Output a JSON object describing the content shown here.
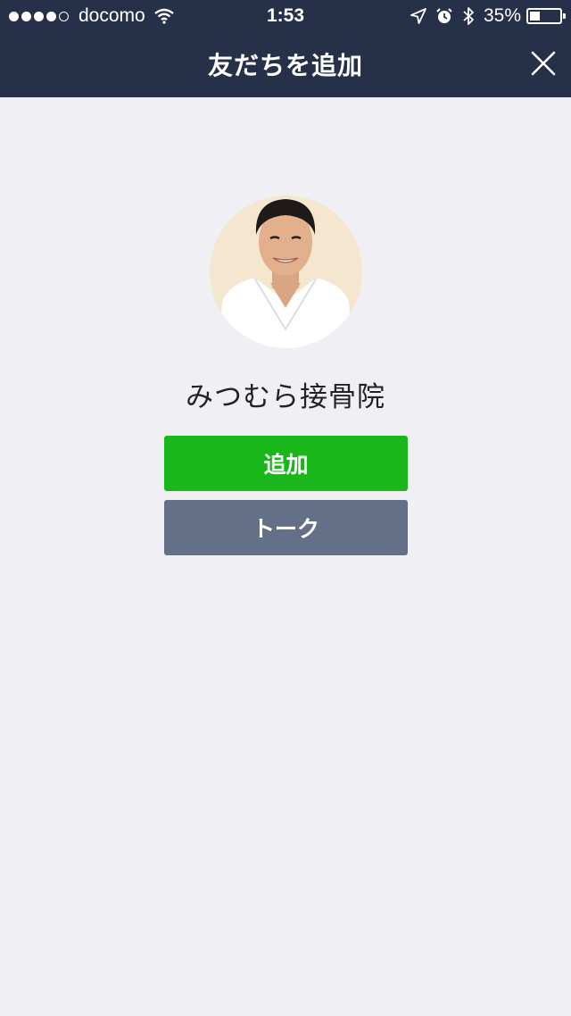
{
  "status_bar": {
    "carrier": "docomo",
    "time": "1:53",
    "battery_percent_label": "35%",
    "battery_level": 0.35
  },
  "header": {
    "title": "友だちを追加",
    "close_icon": "close-icon"
  },
  "profile": {
    "name": "みつむら接骨院"
  },
  "actions": {
    "add_label": "追加",
    "talk_label": "トーク"
  },
  "colors": {
    "header_bg": "#263048",
    "add_button": "#19b719",
    "talk_button": "#647087",
    "page_bg": "#efeff4"
  }
}
